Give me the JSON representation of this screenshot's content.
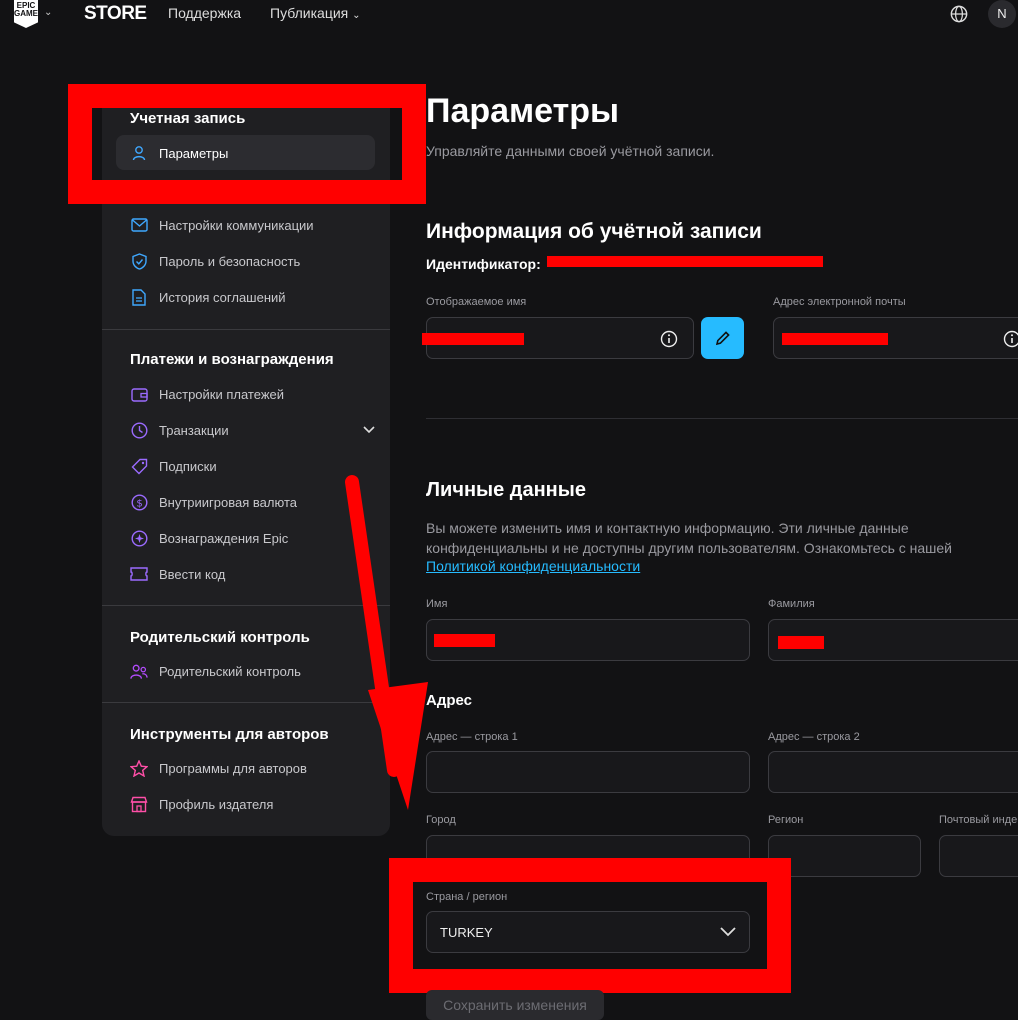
{
  "nav": {
    "logo_text": "EPIC GAMES",
    "store": "STORE",
    "support": "Поддержка",
    "publishing": "Публикация",
    "avatar_initial": "N"
  },
  "sidebar": {
    "section_account": "Учетная запись",
    "item_settings": "Параметры",
    "item_comms": "Настройки коммуникации",
    "item_password": "Пароль и безопасность",
    "item_agreements": "История соглашений",
    "section_payments": "Платежи и вознаграждения",
    "item_payment_settings": "Настройки платежей",
    "item_transactions": "Транзакции",
    "item_subscriptions": "Подписки",
    "item_ingame": "Внутриигровая валюта",
    "item_rewards": "Вознаграждения Epic",
    "item_code": "Ввести код",
    "section_parental": "Родительский контроль",
    "item_parental": "Родительский контроль",
    "section_creators": "Инструменты для авторов",
    "item_creator_programs": "Программы для авторов",
    "item_publisher_profile": "Профиль издателя"
  },
  "main": {
    "title": "Параметры",
    "subtitle": "Управляйте данными своей учётной записи.",
    "account_info_title": "Информация об учётной записи",
    "id_label": "Идентификатор:",
    "display_name_label": "Отображаемое имя",
    "email_label": "Адрес электронной почты",
    "personal_title": "Личные данные",
    "personal_desc": "Вы можете изменить имя и контактную информацию. Эти личные данные конфиденциальны и не доступны другим пользователям. Ознакомьтесь с нашей",
    "privacy_link": "Политикой конфиденциальности",
    "first_name_label": "Имя",
    "last_name_label": "Фамилия",
    "address_title": "Адрес",
    "address1_label": "Адрес — строка 1",
    "address2_label": "Адрес — строка 2",
    "city_label": "Город",
    "region_label": "Регион",
    "postal_label": "Почтовый инде",
    "country_label": "Страна / регион",
    "country_value": "TURKEY",
    "save_button": "Сохранить изменения"
  },
  "colors": {
    "accent": "#26bbff",
    "annotation": "#ff0000",
    "background": "#121214"
  }
}
